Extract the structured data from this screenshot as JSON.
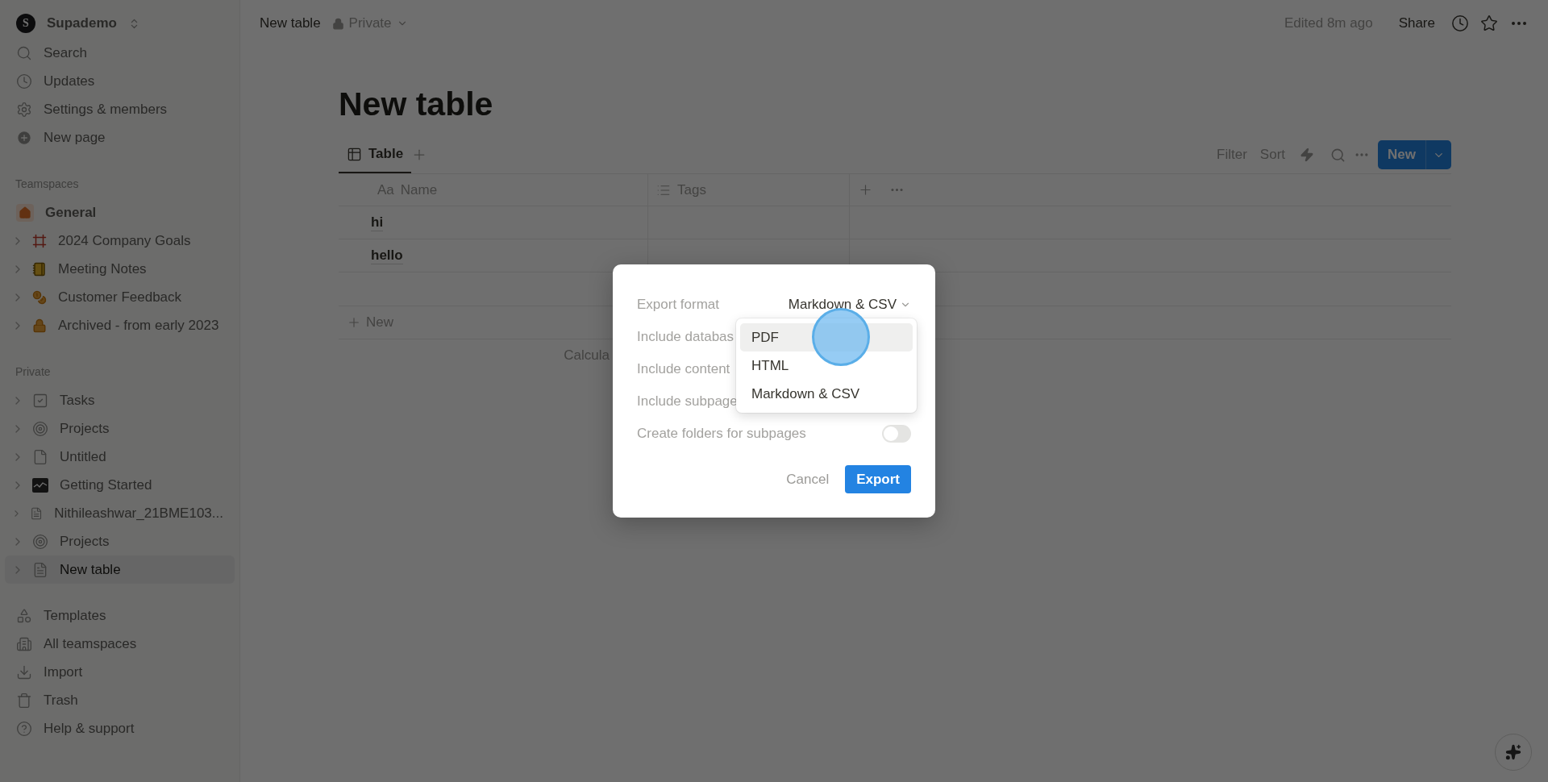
{
  "sidebar": {
    "workspace": {
      "initial": "S",
      "name": "Supademo"
    },
    "nav": [
      {
        "label": "Search"
      },
      {
        "label": "Updates"
      },
      {
        "label": "Settings & members"
      },
      {
        "label": "New page"
      }
    ],
    "teamspaces": {
      "heading": "Teamspaces",
      "items": [
        {
          "label": "General",
          "kind": "teamspace",
          "selected": false
        },
        {
          "label": "2024 Company Goals",
          "kind": "page",
          "selected": false
        },
        {
          "label": "Meeting Notes",
          "kind": "page",
          "selected": false
        },
        {
          "label": "Customer Feedback",
          "kind": "page",
          "selected": false
        },
        {
          "label": "Archived - from early 2023",
          "kind": "page",
          "selected": false
        }
      ]
    },
    "private": {
      "heading": "Private",
      "items": [
        {
          "label": "Tasks",
          "kind": "page",
          "selected": false
        },
        {
          "label": "Projects",
          "kind": "page",
          "selected": false
        },
        {
          "label": "Untitled",
          "kind": "page",
          "selected": false
        },
        {
          "label": "Getting Started",
          "kind": "page",
          "selected": false
        },
        {
          "label": "Nithileashwar_21BME103...",
          "kind": "page",
          "selected": false
        },
        {
          "label": "Projects",
          "kind": "page",
          "selected": false
        },
        {
          "label": "New table",
          "kind": "page",
          "selected": true
        }
      ]
    },
    "bottom": [
      {
        "label": "Templates"
      },
      {
        "label": "All teamspaces"
      },
      {
        "label": "Import"
      },
      {
        "label": "Trash"
      },
      {
        "label": "Help & support"
      }
    ]
  },
  "topbar": {
    "breadcrumb": "New table",
    "privacy": "Private",
    "edited": "Edited 8m ago",
    "share": "Share"
  },
  "page": {
    "title": "New table",
    "views": [
      {
        "label": "Table",
        "selected": true
      }
    ],
    "toolbar": {
      "filter": "Filter",
      "sort": "Sort",
      "new_button": "New"
    },
    "table": {
      "columns": [
        {
          "label": "Name",
          "prefix": "Aa",
          "kind": "title"
        },
        {
          "label": "Tags",
          "kind": "multi"
        }
      ],
      "rows": [
        [
          "hi",
          ""
        ],
        [
          "hello",
          ""
        ]
      ],
      "add_row": "New",
      "footer": "Calcula"
    }
  },
  "dialog": {
    "rows": [
      {
        "label": "Export format",
        "kind": "select",
        "value": "Markdown & CSV"
      },
      {
        "label": "Include databas",
        "kind": "label"
      },
      {
        "label": "Include content",
        "kind": "label"
      },
      {
        "label": "Include subpage",
        "kind": "label"
      },
      {
        "label": "Create folders for subpages",
        "kind": "toggle",
        "on": false
      }
    ],
    "cancel": "Cancel",
    "confirm": "Export",
    "menu": [
      {
        "label": "PDF",
        "selected": true
      },
      {
        "label": "HTML",
        "selected": false
      },
      {
        "label": "Markdown & CSV",
        "selected": false
      }
    ]
  }
}
